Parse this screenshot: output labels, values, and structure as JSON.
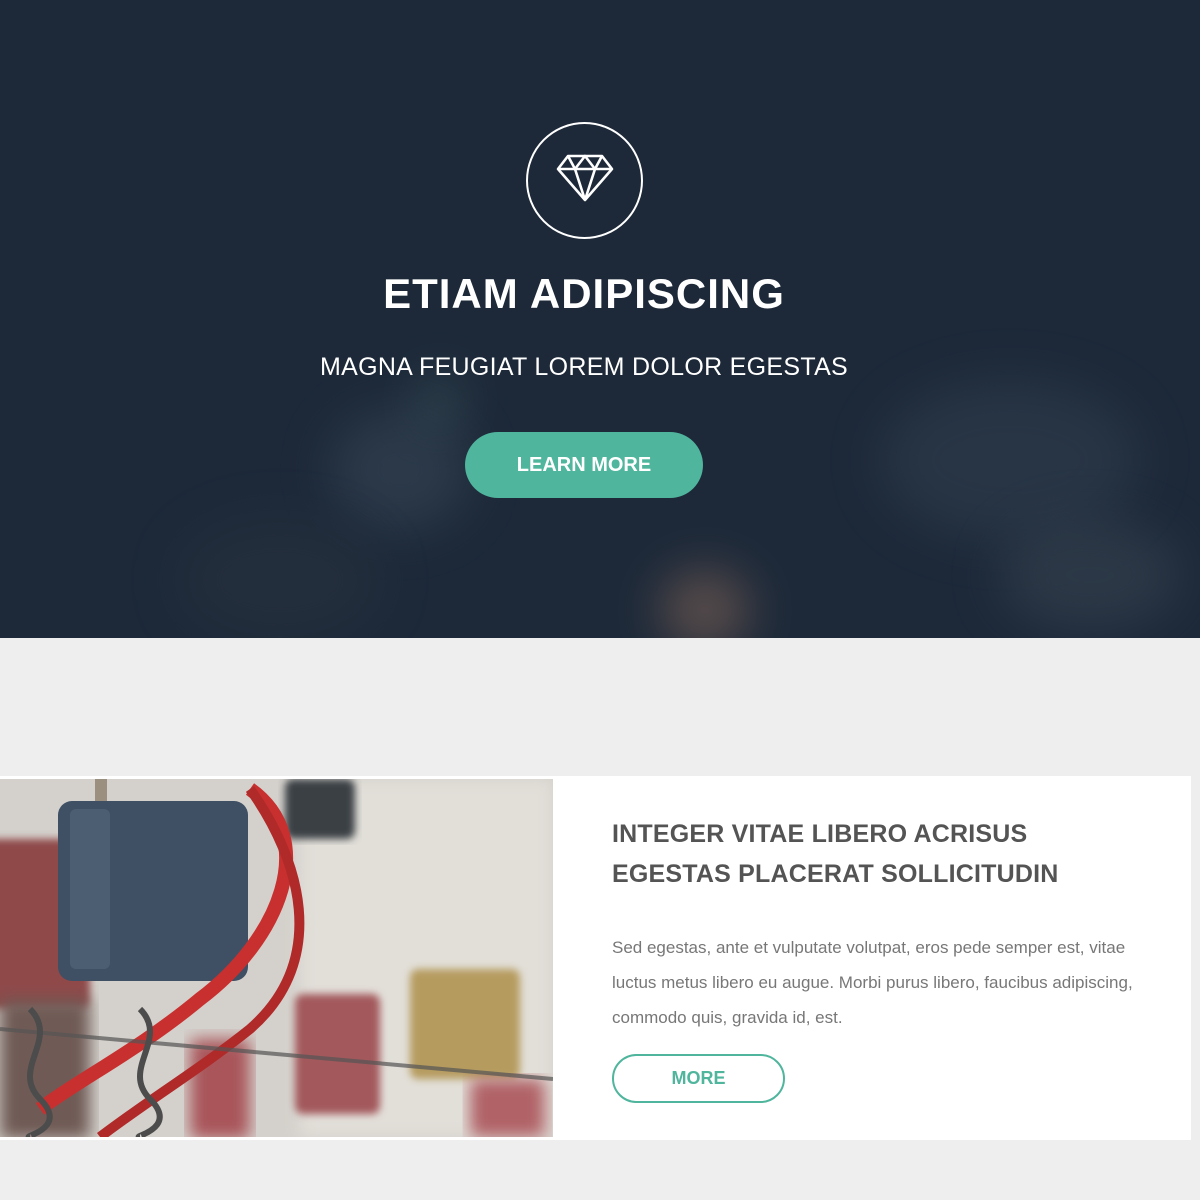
{
  "hero": {
    "icon": "diamond-icon",
    "title": "ETIAM ADIPISCING",
    "subtitle": "MAGNA FEUGIAT LOREM DOLOR EGESTAS",
    "button_label": "LEARN MORE",
    "background_color": "#1d2939",
    "accent_color": "#4fb59d"
  },
  "feature": {
    "image": "padlocks-photo",
    "title": "INTEGER VITAE LIBERO ACRISUS EGESTAS PLACERAT SOLLICITUDIN",
    "body": "Sed egestas, ante et vulputate volutpat, eros pede semper est, vitae luctus metus libero eu augue. Morbi purus libero, faucibus adipiscing, commodo quis, gravida id, est.",
    "button_label": "MORE"
  }
}
